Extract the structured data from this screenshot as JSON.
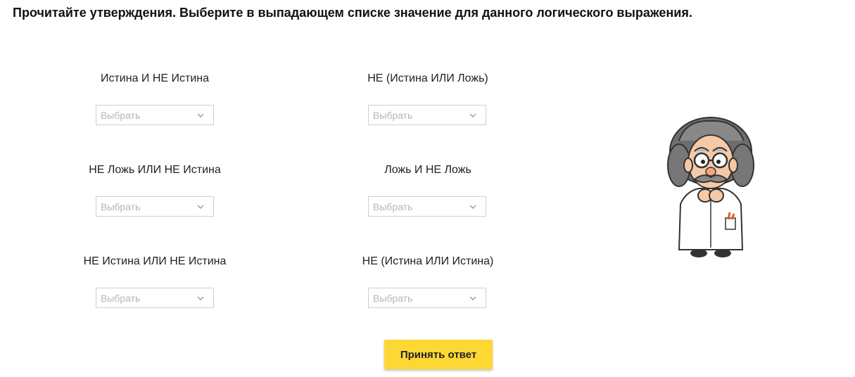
{
  "instruction": "Прочитайте утверждения. Выберите в выпадающем списке значение для данного логического выражения.",
  "statements": [
    {
      "text": "Истина И НЕ Истина",
      "placeholder": "Выбрать"
    },
    {
      "text": "НЕ (Истина ИЛИ Ложь)",
      "placeholder": "Выбрать"
    },
    {
      "text": "НЕ Ложь ИЛИ НЕ Истина",
      "placeholder": "Выбрать"
    },
    {
      "text": "Ложь И НЕ Ложь",
      "placeholder": "Выбрать"
    },
    {
      "text": "НЕ Истина ИЛИ НЕ Истина",
      "placeholder": "Выбрать"
    },
    {
      "text": "НЕ (Истина ИЛИ Истина)",
      "placeholder": "Выбрать"
    }
  ],
  "submit_label": "Принять ответ",
  "colors": {
    "accent_button": "#fdd835",
    "placeholder_text": "#b5b5b5",
    "select_border": "#cfcfcf"
  },
  "icons": {
    "select_arrow": "chevron-down-icon",
    "mascot": "scientist-illustration"
  }
}
